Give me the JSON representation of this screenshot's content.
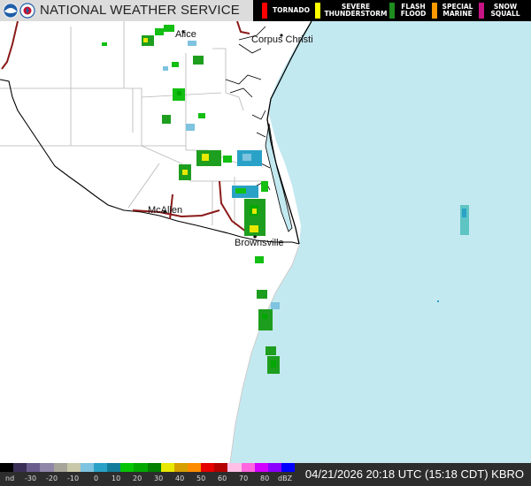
{
  "header": {
    "agency": "NATIONAL WEATHER SERVICE",
    "warnings": [
      {
        "label": "TORNADO",
        "color": "#ff0000"
      },
      {
        "label": "SEVERE THUNDERSTORM",
        "color": "#ffff00"
      },
      {
        "label": "FLASH FLOOD",
        "color": "#1e8c1e"
      },
      {
        "label": "SPECIAL MARINE",
        "color": "#ff9900"
      },
      {
        "label": "SNOW SQUALL",
        "color": "#c71585"
      }
    ]
  },
  "map": {
    "cities": [
      "Alice",
      "Corpus Christi",
      "McAllen",
      "Brownsville"
    ],
    "colors": {
      "land": "#ffffff",
      "water": "#c3e9f0",
      "coast": "#000000",
      "county_lines": "#b0b0b0",
      "highways": "#8b1a1a"
    }
  },
  "footer": {
    "scale_labels": [
      "nd",
      "-30",
      "-20",
      "-10",
      "0",
      "10",
      "20",
      "30",
      "40",
      "50",
      "60",
      "70",
      "80",
      "dBZ"
    ],
    "scale_colors": [
      "#000000",
      "#3b2f57",
      "#6a5d8e",
      "#8f86a8",
      "#a7a59a",
      "#c9c9aa",
      "#7ec3e0",
      "#2aa2c7",
      "#127d9a",
      "#06c506",
      "#02a802",
      "#028002",
      "#e8e800",
      "#d6a000",
      "#ff8c00",
      "#e60000",
      "#b40000",
      "#ffc0e8",
      "#ff66e0",
      "#d100ff",
      "#8c00ff",
      "#0000ff"
    ],
    "timestamp": "04/21/2026 20:18 UTC (15:18 CDT) KBRO"
  }
}
